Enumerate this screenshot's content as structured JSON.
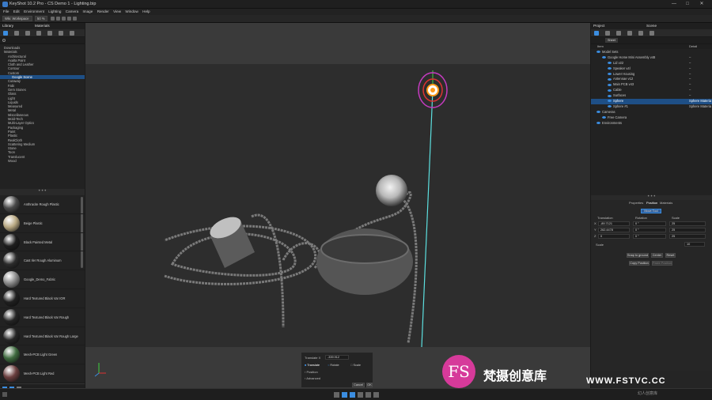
{
  "window": {
    "title": "KeyShot 10.2 Pro - CS Demo 1 - Lighting.bip",
    "controls": [
      "—",
      "□",
      "✕"
    ]
  },
  "menu": [
    "File",
    "Edit",
    "Environment",
    "Lighting",
    "Camera",
    "Image",
    "Render",
    "View",
    "Window",
    "Help"
  ],
  "toolbar": {
    "workspace": "Wkr. Workspace",
    "zoom": "50 %"
  },
  "library": {
    "title": "Library",
    "tab": "Materials",
    "tree": [
      {
        "label": "Downloads",
        "indent": 1,
        "selected": false
      },
      {
        "label": "Materials",
        "indent": 1,
        "selected": false
      },
      {
        "label": "Architectural",
        "indent": 2,
        "selected": false
      },
      {
        "label": "Axalta Paint",
        "indent": 2,
        "selected": false
      },
      {
        "label": "Cloth and Leather",
        "indent": 2,
        "selected": false
      },
      {
        "label": "Contour",
        "indent": 2,
        "selected": false
      },
      {
        "label": "Custom",
        "indent": 2,
        "selected": false
      },
      {
        "label": "Google Scene",
        "indent": 3,
        "selected": true
      },
      {
        "label": "Cutaway",
        "indent": 2,
        "selected": false
      },
      {
        "label": "Fabi",
        "indent": 2,
        "selected": false
      },
      {
        "label": "Gem Stones",
        "indent": 2,
        "selected": false
      },
      {
        "label": "Glass",
        "indent": 2,
        "selected": false
      },
      {
        "label": "Light",
        "indent": 2,
        "selected": false
      },
      {
        "label": "Liquids",
        "indent": 2,
        "selected": false
      },
      {
        "label": "Measured",
        "indent": 2,
        "selected": false
      },
      {
        "label": "Metal",
        "indent": 2,
        "selected": false
      },
      {
        "label": "Miscellaneous",
        "indent": 2,
        "selected": false
      },
      {
        "label": "Mold-Tech",
        "indent": 2,
        "selected": false
      },
      {
        "label": "Multi-Layer Optics",
        "indent": 2,
        "selected": false
      },
      {
        "label": "Packaging",
        "indent": 2,
        "selected": false
      },
      {
        "label": "Paint",
        "indent": 2,
        "selected": false
      },
      {
        "label": "Plastic",
        "indent": 2,
        "selected": false
      },
      {
        "label": "RealCloth",
        "indent": 2,
        "selected": false
      },
      {
        "label": "Scattering Medium",
        "indent": 2,
        "selected": false
      },
      {
        "label": "Stone",
        "indent": 2,
        "selected": false
      },
      {
        "label": "Toon",
        "indent": 2,
        "selected": false
      },
      {
        "label": "Translucent",
        "indent": 2,
        "selected": false
      },
      {
        "label": "Wood",
        "indent": 2,
        "selected": false
      }
    ],
    "materials": [
      {
        "name": "Anthracite Rough Plastic",
        "color": "#4a4a4a"
      },
      {
        "name": "Beige Plastic",
        "color": "#b8a882"
      },
      {
        "name": "Black Painted Metal",
        "color": "#1e1e1e"
      },
      {
        "name": "Cast Iler Rough Aluminum",
        "color": "#2c2c2c"
      },
      {
        "name": "Google_Demo_Fabric",
        "color": "#8a8a8a"
      },
      {
        "name": "Hard Textured Black Var IOR",
        "color": "#202020"
      },
      {
        "name": "Hard Textured Black Var Rough",
        "color": "#242424"
      },
      {
        "name": "Hard Textured Black Var Rough Large",
        "color": "#262626"
      },
      {
        "name": "Mesh-PCB Light Green",
        "color": "#3f6b3f"
      },
      {
        "name": "Mesh-PCB Light Red",
        "color": "#6b3f3f"
      }
    ]
  },
  "scene": {
    "project_title": "Project",
    "title": "Scene",
    "filter_label": "Sheet",
    "col_name": "Item",
    "col_detail": "Detail",
    "rows": [
      {
        "label": "Model Sets",
        "indent": 1,
        "detail": "",
        "selected": false
      },
      {
        "label": "Google Home Mini Assembly v48",
        "indent": 2,
        "detail": "–",
        "selected": false
      },
      {
        "label": "Lid v22",
        "indent": 3,
        "detail": "–",
        "selected": false
      },
      {
        "label": "Speaker v4l",
        "indent": 3,
        "detail": "–",
        "selected": false
      },
      {
        "label": "Lower Housing",
        "indent": 3,
        "detail": "–",
        "selected": false
      },
      {
        "label": "Antennae v12",
        "indent": 3,
        "detail": "–",
        "selected": false
      },
      {
        "label": "Main PCB v43",
        "indent": 3,
        "detail": "–",
        "selected": false
      },
      {
        "label": "Cable",
        "indent": 3,
        "detail": "–",
        "selected": false
      },
      {
        "label": "Surfaces",
        "indent": 3,
        "detail": "–",
        "selected": false
      },
      {
        "label": "Sphere",
        "indent": 3,
        "detail": "Sphere Materia",
        "selected": true
      },
      {
        "label": "Sphere #1",
        "indent": 3,
        "detail": "Sphere Materia",
        "selected": false
      },
      {
        "label": "Cameras",
        "indent": 1,
        "detail": "",
        "selected": false
      },
      {
        "label": "Free Camera",
        "indent": 2,
        "detail": "",
        "selected": false
      },
      {
        "label": "Environments",
        "indent": 1,
        "detail": "",
        "selected": false
      }
    ],
    "tabs": [
      "Properties",
      "Position",
      "Materials"
    ],
    "active_tab": "Position",
    "move_tool": "Move Tool",
    "headers": [
      "Translation",
      "Rotation",
      "Scale"
    ],
    "xyz": [
      {
        "axis": "X",
        "t": "-89.7121",
        "r": "0 °",
        "s": "25"
      },
      {
        "axis": "Y",
        "t": "262.4478",
        "r": "0 °",
        "s": "25"
      },
      {
        "axis": "Z",
        "t": "0",
        "r": "0 °",
        "s": "25"
      }
    ],
    "scale_label": "Scale",
    "scale_value": "10",
    "snap": "Snap to ground",
    "center": "Center",
    "reset": "Reset",
    "copy": "Copy Position",
    "paste": "Paste Position"
  },
  "transform_popup": {
    "field_label": "Translate X",
    "field_value": "-339.912",
    "modes": [
      "Translate",
      "Rotate",
      "Scale"
    ],
    "sections": [
      "Position",
      "Advanced"
    ],
    "cancel": "Cancel",
    "ok": "OK"
  },
  "watermark": {
    "logo": "FS",
    "cn": "梵摄创意库",
    "url": "WWW.FSTVC.CC"
  },
  "colors": {
    "accent": "#3b8de0",
    "selection": "#1e4f86",
    "viewport_bg": "#2c2c2c",
    "gizmo_ring": "#ff9a1a",
    "gizmo_axis": "#5ce0e0"
  },
  "footer_credit": "幻人创意库"
}
